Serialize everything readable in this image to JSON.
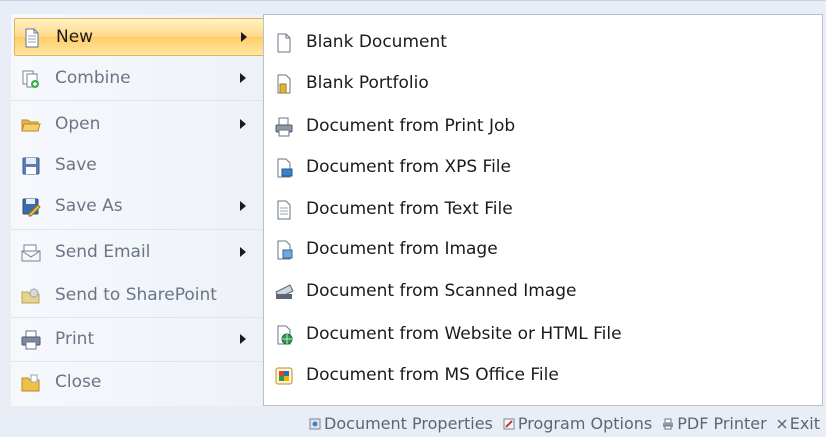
{
  "left_menu": {
    "new_label": "New",
    "combine_label": "Combine",
    "open_label": "Open",
    "save_label": "Save",
    "save_as_label": "Save As",
    "send_email_label": "Send Email",
    "send_sharepoint_label": "Send to SharePoint",
    "print_label": "Print",
    "close_label": "Close"
  },
  "submenu": {
    "items": [
      {
        "label": "Blank Document",
        "icon": "blank-document-icon"
      },
      {
        "label": "Blank Portfolio",
        "icon": "blank-portfolio-icon"
      },
      {
        "label": "Document from Print Job",
        "icon": "print-job-icon"
      },
      {
        "label": "Document from XPS File",
        "icon": "xps-file-icon"
      },
      {
        "label": "Document from Text File",
        "icon": "text-file-icon"
      },
      {
        "label": "Document from Image",
        "icon": "image-file-icon"
      },
      {
        "label": "Document from Scanned Image",
        "icon": "scanner-icon"
      },
      {
        "label": "Document from Website or HTML File",
        "icon": "web-file-icon"
      },
      {
        "label": "Document from MS Office File",
        "icon": "office-file-icon"
      }
    ]
  },
  "bottom_bar": {
    "document_properties_label": "Document Properties",
    "program_options_label": "Program Options",
    "pdf_printer_label": "PDF Printer",
    "exit_label": "Exit"
  },
  "colors": {
    "selected_highlight": "#ffd98b",
    "menu_background": "#e9eef6",
    "submenu_background": "#ffffff"
  }
}
